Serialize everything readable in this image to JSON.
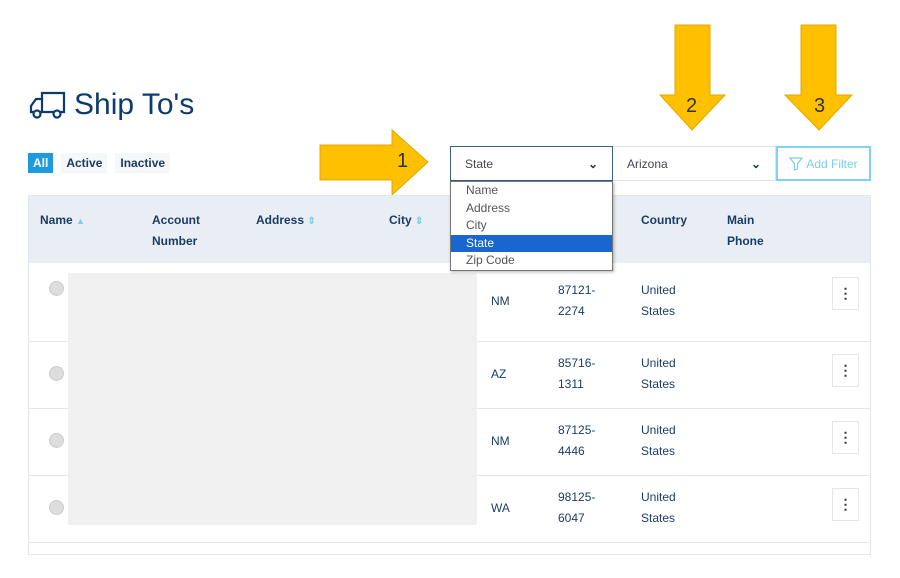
{
  "page": {
    "title": "Ship To's",
    "icon": "truck-icon"
  },
  "tabs": [
    {
      "label": "All",
      "active": true
    },
    {
      "label": "Active"
    },
    {
      "label": "Inactive"
    }
  ],
  "filter": {
    "field": "State",
    "value": "Arizona",
    "options": [
      "Name",
      "Address",
      "City",
      "State",
      "Zip Code"
    ],
    "highlighted": "State",
    "add_filter": "Add Filter"
  },
  "headers": {
    "name": "Name",
    "account": "Account",
    "number": "Number",
    "address": "Address",
    "city": "City",
    "country": "Country",
    "main": "Main",
    "phone": "Phone"
  },
  "rows": [
    {
      "state": "NM",
      "zip1": "87121-",
      "zip2": "2274",
      "c1": "United",
      "c2": "States"
    },
    {
      "state": "AZ",
      "zip1": "85716-",
      "zip2": "1311",
      "c1": "United",
      "c2": "States"
    },
    {
      "state": "NM",
      "zip1": "87125-",
      "zip2": "4446",
      "c1": "United",
      "c2": "States"
    },
    {
      "state": "WA",
      "zip1": "98125-",
      "zip2": "6047",
      "c1": "United",
      "c2": "States"
    }
  ],
  "annotations": [
    "1",
    "2",
    "3"
  ],
  "colors": {
    "accent": "#1e9be0",
    "arrow": "#ffc000",
    "brand": "#0d3b6e",
    "highlight": "#1a66d0"
  }
}
